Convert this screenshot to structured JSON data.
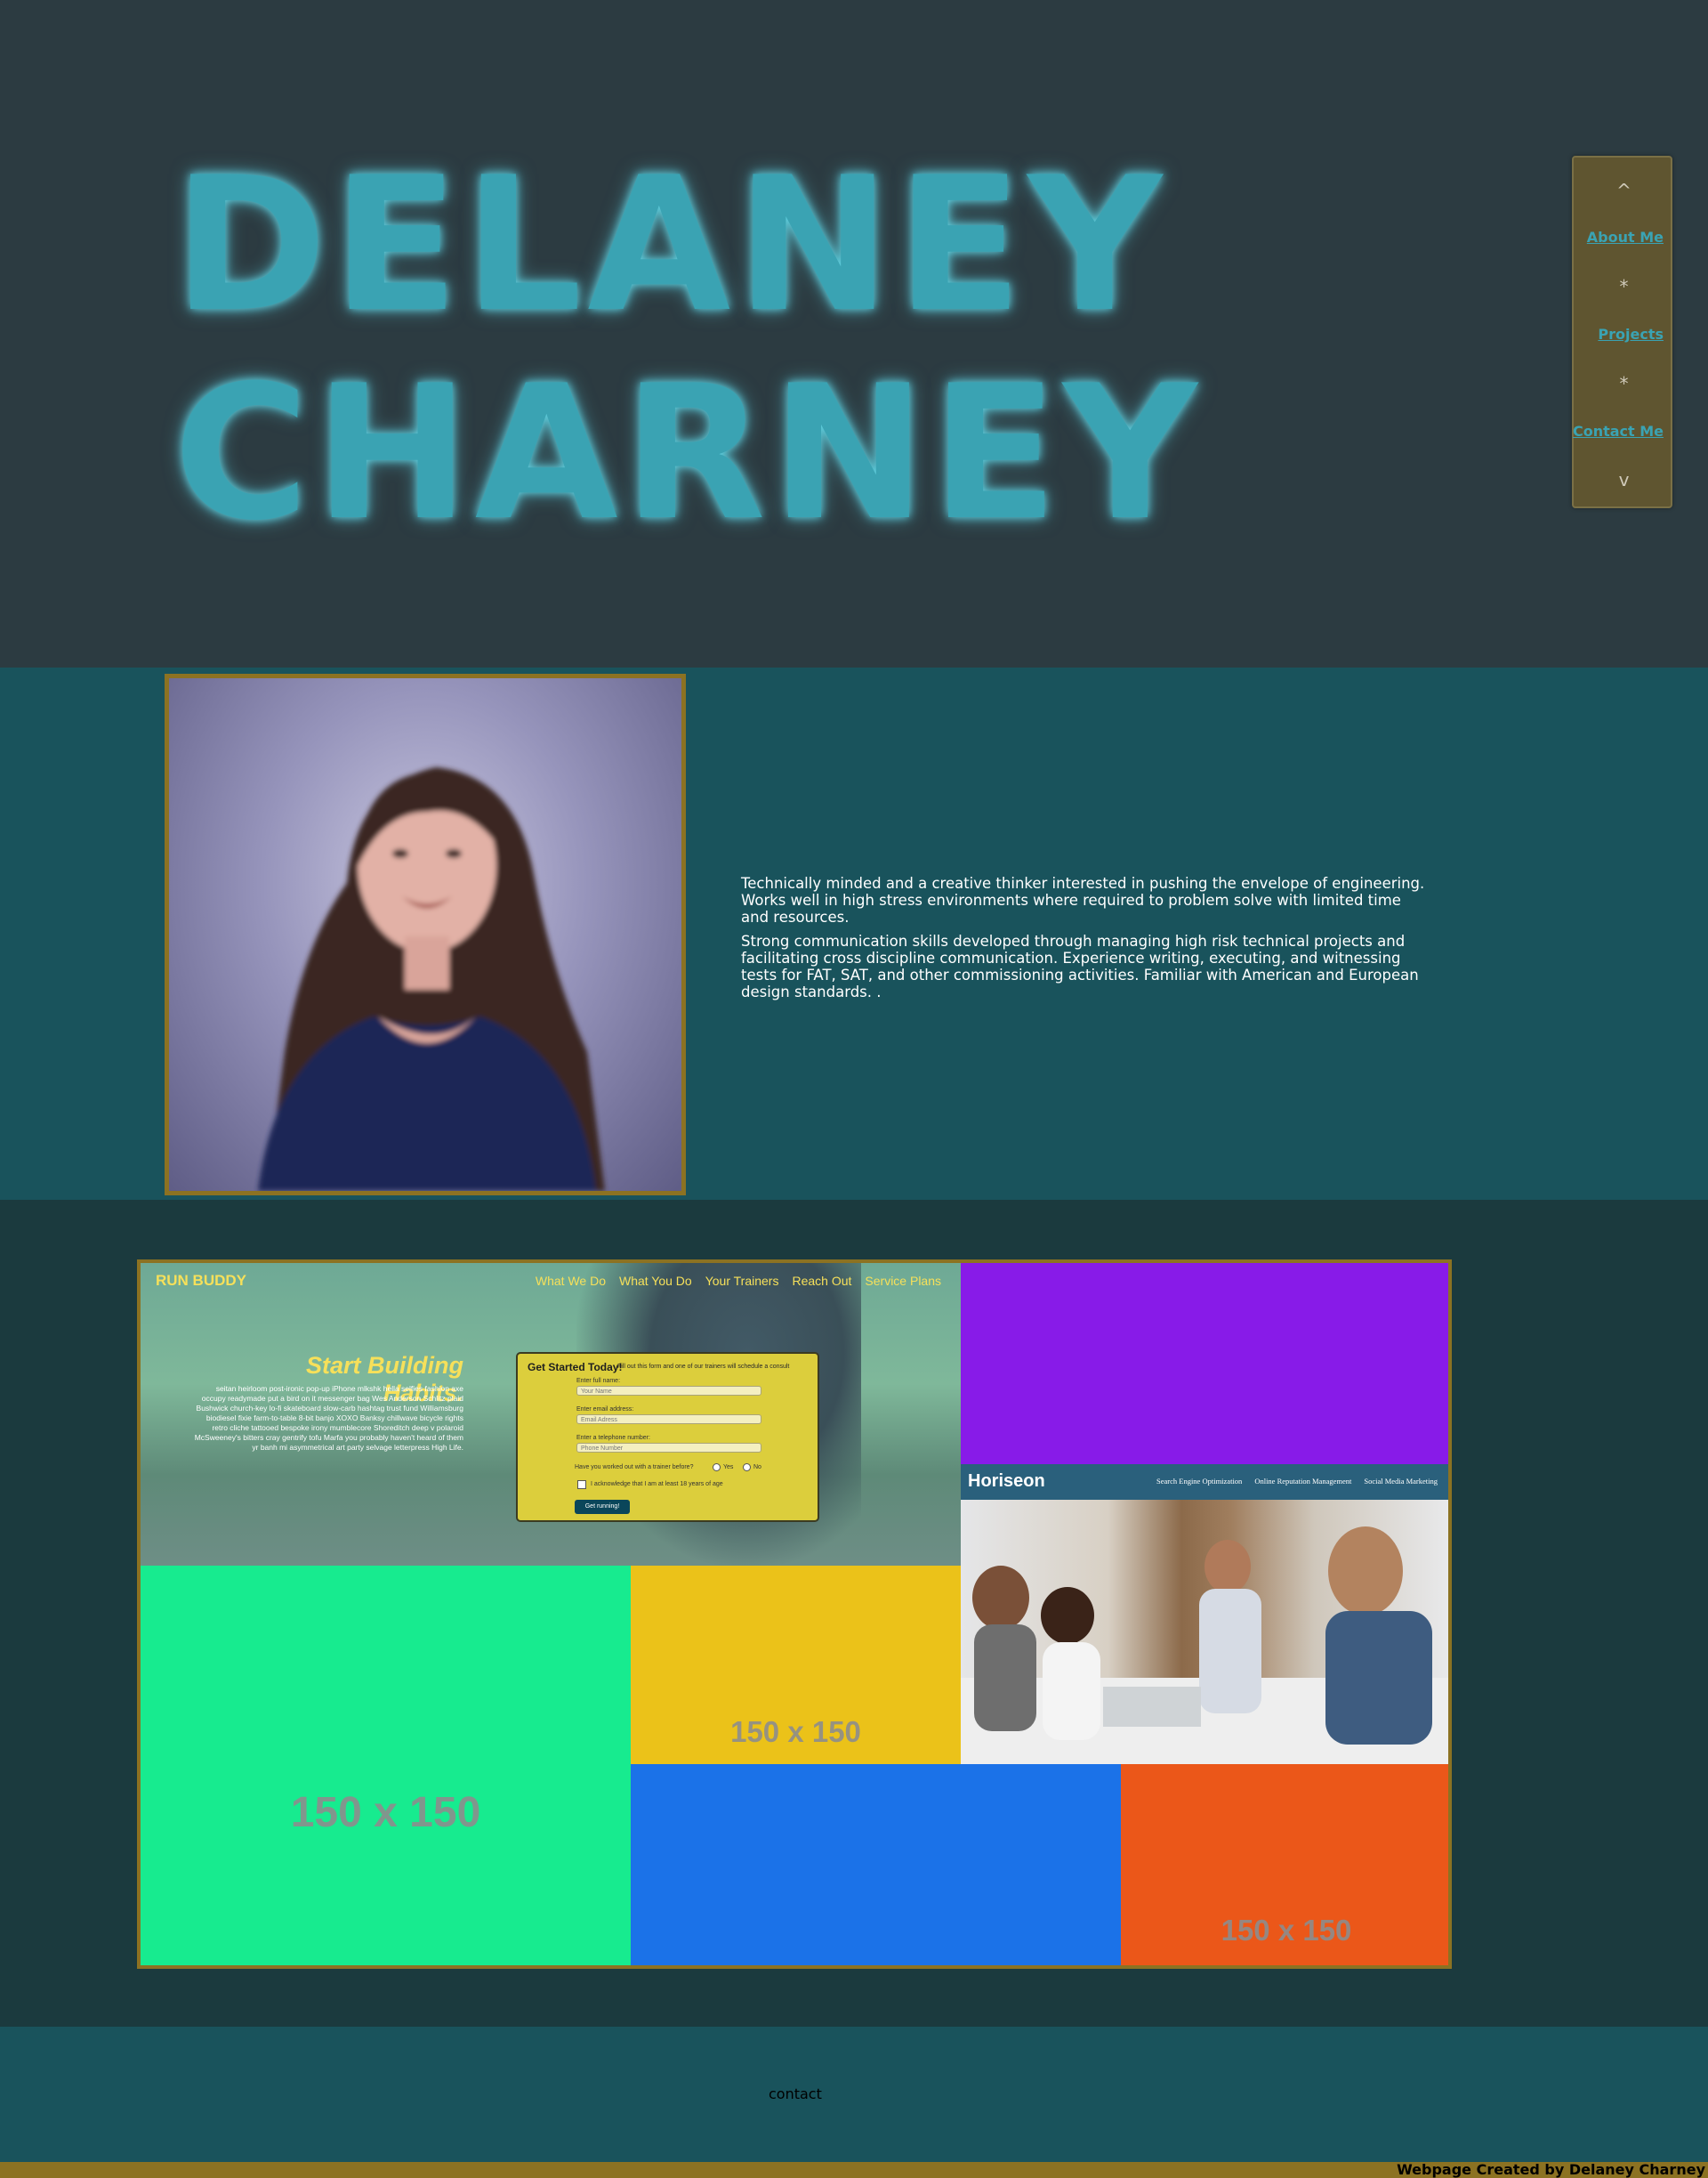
{
  "header": {
    "name_line1": "DELANEY",
    "name_line2": "CHARNEY"
  },
  "nav": {
    "up_arrow": "^",
    "items": [
      {
        "label": "About Me"
      },
      {
        "label": "Projects"
      },
      {
        "label": "Contact Me"
      }
    ],
    "separator": "*",
    "down_arrow": "v"
  },
  "about": {
    "paragraph1": "Technically minded and a creative thinker interested in pushing the envelope of engineering. Works well in high stress environments where required to problem solve with limited time and resources.",
    "paragraph2": "Strong communication skills developed through managing high risk technical projects and facilitating cross discipline communication. Experience writing, executing, and witnessing tests for FAT, SAT, and other commissioning activities. Familiar with American and European design standards. ."
  },
  "projects": {
    "run_buddy": {
      "logo": "RUN BUDDY",
      "nav": [
        "What We Do",
        "What You Do",
        "Your Trainers",
        "Reach Out",
        "Service Plans"
      ],
      "hero_title": "Start Building Habits.",
      "hero_text": "seitan heirloom post-ironic pop-up iPhone mlkshk hella selfies fashion axe occupy readymade put a bird on it messenger bag Wes Anderson Schlitz plaid Bushwick church-key lo-fi skateboard slow-carb hashtag trust fund Williamsburg biodiesel fixie farm-to-table 8-bit banjo XOXO Banksy chillwave bicycle rights retro cliche tattooed bespoke irony mumblecore Shoreditch deep v polaroid McSweeney's bitters cray gentrify tofu Marfa you probably haven't heard of them yr banh mi asymmetrical art party selvage letterpress High Life.",
      "form": {
        "title": "Get Started Today!",
        "subtitle": "Fill out this form and one of our trainers will schedule a consult",
        "name_label": "Enter full name:",
        "name_placeholder": "Your Name",
        "email_label": "Enter email address:",
        "email_placeholder": "Email Adress",
        "phone_label": "Enter a telephone number:",
        "phone_placeholder": "Phone Number",
        "question": "Have you worked out with a trainer before?",
        "yes": "Yes",
        "no": "No",
        "ack": "I acknowledge that I am at least 18 years of age",
        "submit": "Get running!"
      }
    },
    "horiseon": {
      "logo": "Horiseon",
      "links": [
        "Search Engine Optimization",
        "Online Reputation Management",
        "Social Media Marketing"
      ]
    },
    "placeholder_label": "150 x 150",
    "colors": {
      "purple": "#881be8",
      "green": "#17eb8f",
      "yellow": "#ebc219",
      "blue": "#1b72e8",
      "orange": "#eb5719"
    }
  },
  "contact": {
    "label": "contact"
  },
  "footer": {
    "credit": "Webpage Created by Delaney Charney"
  }
}
